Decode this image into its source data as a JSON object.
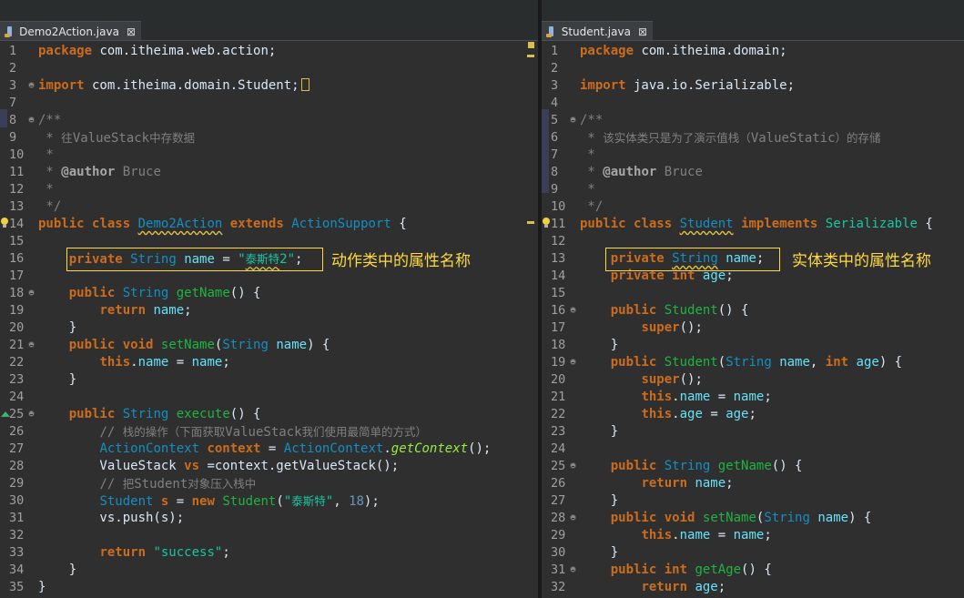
{
  "left": {
    "tab_label": "Demo2Action.java",
    "close_glyph": "⊠",
    "callout": "动作类中的属性名称",
    "lines": [
      {
        "n": "1",
        "html": "<span class='kw'>package</span> com.itheima.web.action;"
      },
      {
        "n": "2",
        "html": ""
      },
      {
        "n": "3",
        "fold": true,
        "html": "<span class='kw'>import</span> com.itheima.domain.Student;<span class='cursor-box'></span>"
      },
      {
        "n": "7",
        "html": ""
      },
      {
        "n": "8",
        "fold": true,
        "html": "<span class='jd'>/**</span>"
      },
      {
        "n": "9",
        "html": "<span class='jd'> * <span class='cjk'>往</span>ValueStack<span class='cjk'>中存数据</span></span>"
      },
      {
        "n": "10",
        "html": "<span class='jd'> *</span>"
      },
      {
        "n": "11",
        "html": "<span class='jd'> * <span class='ann'>@author</span> Bruce</span>"
      },
      {
        "n": "12",
        "html": "<span class='jd'> *</span>"
      },
      {
        "n": "13",
        "html": "<span class='jd'> */</span>"
      },
      {
        "n": "14",
        "bulb": true,
        "html": "<span class='kw'>public</span> <span class='kw'>class</span> <span class='cls wavy'>Demo2Action</span> <span class='kw'>extends</span> <span class='cls'>ActionSupport</span> {"
      },
      {
        "n": "15",
        "html": ""
      },
      {
        "n": "16",
        "html": "    <span class='kw'>private</span> <span class='ty'>String</span> <span class='fld'>name</span> = <span class='st'>\"<span class='cjk wavy'>泰斯特</span>2\"</span>;"
      },
      {
        "n": "17",
        "html": ""
      },
      {
        "n": "18",
        "fold": true,
        "html": "    <span class='kw'>public</span> <span class='ty'>String</span> <span class='mth'>getName</span>() {"
      },
      {
        "n": "19",
        "html": "        <span class='kw'>return</span> <span class='fld'>name</span>;"
      },
      {
        "n": "20",
        "html": "    }"
      },
      {
        "n": "21",
        "fold": true,
        "html": "    <span class='kw'>public</span> <span class='kw'>void</span> <span class='mth'>setName</span>(<span class='ty'>String</span> <span class='fld'>name</span>) {"
      },
      {
        "n": "22",
        "html": "        <span class='kw'>this</span>.<span class='fld'>name</span> = <span class='fld'>name</span>;"
      },
      {
        "n": "23",
        "html": "    }"
      },
      {
        "n": "24",
        "html": ""
      },
      {
        "n": "25",
        "fold": true,
        "arrow": true,
        "html": "    <span class='kw'>public</span> <span class='ty'>String</span> <span class='mth'>execute</span>() {"
      },
      {
        "n": "26",
        "html": "        <span class='cm'>// <span class='cjk'>栈的操作（下面获取</span>ValueStack<span class='cjk'>我们使用最简单的方式）</span></span>"
      },
      {
        "n": "27",
        "html": "        <span class='cls'>ActionContext</span> <span class='kw' style='font-weight:bold;color:#cc6c1d'>context</span> = <span class='cls'>ActionContext</span>.<span class='it'>getContext</span>();"
      },
      {
        "n": "28",
        "html": "        ValueStack <span class='kw'>vs</span> =context.getValueStack();"
      },
      {
        "n": "29",
        "html": "        <span class='cm'>// <span class='cjk'>把</span>Student<span class='cjk'>对象压入栈中</span></span>"
      },
      {
        "n": "30",
        "html": "        <span class='cls'>Student</span> <span class='kw'>s</span> = <span class='kw'>new</span> <span class='mth' style='color:#1eb540;font-weight:normal'>Student</span>(<span class='st'>\"<span class='cjk'>泰斯特</span>\"</span>, <span class='num'>18</span>);"
      },
      {
        "n": "31",
        "html": "        vs.push(s);"
      },
      {
        "n": "32",
        "html": ""
      },
      {
        "n": "33",
        "html": "        <span class='kw'>return</span> <span class='st'>\"success\"</span>;"
      },
      {
        "n": "34",
        "html": "    }"
      },
      {
        "n": "35",
        "html": "}"
      }
    ]
  },
  "right": {
    "tab_label": "Student.java",
    "close_glyph": "⊠",
    "callout": "实体类中的属性名称",
    "lines": [
      {
        "n": "1",
        "html": "<span class='kw'>package</span> com.itheima.domain;"
      },
      {
        "n": "2",
        "html": ""
      },
      {
        "n": "3",
        "html": "<span class='kw'>import</span> java.io.Serializable;"
      },
      {
        "n": "4",
        "html": ""
      },
      {
        "n": "5",
        "fold": true,
        "html": "<span class='jd'>/**</span>"
      },
      {
        "n": "6",
        "html": "<span class='jd'> * <span class='cjk'>该实体类只是为了演示值栈（</span>ValueStatic<span class='cjk'>）的存储</span></span>"
      },
      {
        "n": "7",
        "html": "<span class='jd'> *</span>"
      },
      {
        "n": "8",
        "html": "<span class='jd'> * <span class='ann'>@author</span> Bruce</span>"
      },
      {
        "n": "9",
        "html": "<span class='jd'> *</span>"
      },
      {
        "n": "10",
        "html": "<span class='jd'> */</span>"
      },
      {
        "n": "11",
        "bulb": true,
        "html": "<span class='kw'>public</span> <span class='kw'>class</span> <span class='cls wavy'>Student</span> <span class='kw'>implements</span> <span class='st'>Serializable</span> {"
      },
      {
        "n": "12",
        "html": ""
      },
      {
        "n": "13",
        "html": "    <span class='kw'>private</span> <span class='ty wavy'>String</span> <span class='fld'>name</span>;"
      },
      {
        "n": "14",
        "html": "    <span class='kw'>private</span> <span class='kw'>int</span> <span class='fld'>age</span>;"
      },
      {
        "n": "15",
        "html": ""
      },
      {
        "n": "16",
        "fold": true,
        "html": "    <span class='kw'>public</span> <span class='mth'>Student</span>() {"
      },
      {
        "n": "17",
        "html": "        <span class='kw'>super</span>();"
      },
      {
        "n": "18",
        "html": "    }"
      },
      {
        "n": "19",
        "fold": true,
        "html": "    <span class='kw'>public</span> <span class='mth'>Student</span>(<span class='ty'>String</span> <span class='fld'>name</span>, <span class='kw'>int</span> <span class='fld'>age</span>) {"
      },
      {
        "n": "20",
        "html": "        <span class='kw'>super</span>();"
      },
      {
        "n": "21",
        "html": "        <span class='kw'>this</span>.<span class='fld'>name</span> = <span class='fld'>name</span>;"
      },
      {
        "n": "22",
        "html": "        <span class='kw'>this</span>.<span class='fld'>age</span> = <span class='fld'>age</span>;"
      },
      {
        "n": "23",
        "html": "    }"
      },
      {
        "n": "24",
        "html": ""
      },
      {
        "n": "25",
        "fold": true,
        "html": "    <span class='kw'>public</span> <span class='ty'>String</span> <span class='mth'>getName</span>() {"
      },
      {
        "n": "26",
        "html": "        <span class='kw'>return</span> <span class='fld'>name</span>;"
      },
      {
        "n": "27",
        "html": "    }"
      },
      {
        "n": "28",
        "fold": true,
        "html": "    <span class='kw'>public</span> <span class='kw'>void</span> <span class='mth'>setName</span>(<span class='ty'>String</span> <span class='fld'>name</span>) {"
      },
      {
        "n": "29",
        "html": "        <span class='kw'>this</span>.<span class='fld'>name</span> = <span class='fld'>name</span>;"
      },
      {
        "n": "30",
        "html": "    }"
      },
      {
        "n": "31",
        "fold": true,
        "html": "    <span class='kw'>public</span> <span class='kw'>int</span> <span class='mth'>getAge</span>() {"
      },
      {
        "n": "32",
        "html": "        <span class='kw'>return</span> <span class='fld'>age</span>;"
      }
    ]
  }
}
